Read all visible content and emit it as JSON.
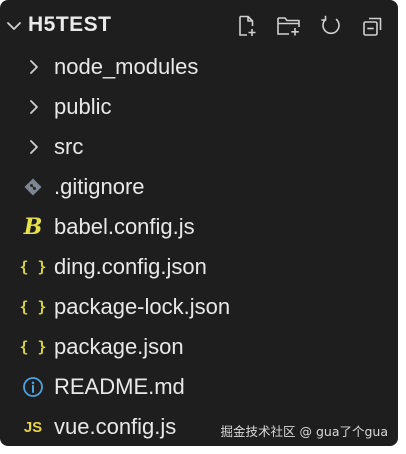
{
  "explorer": {
    "title": "H5TEST",
    "toolbar": [
      {
        "name": "new-file-icon",
        "icon": "new-file"
      },
      {
        "name": "new-folder-icon",
        "icon": "new-folder"
      },
      {
        "name": "refresh-icon",
        "icon": "refresh"
      },
      {
        "name": "collapse-all-icon",
        "icon": "collapse-all"
      }
    ],
    "items": [
      {
        "label": "node_modules",
        "type": "folder",
        "icon": "chevron-right"
      },
      {
        "label": "public",
        "type": "folder",
        "icon": "chevron-right"
      },
      {
        "label": "src",
        "type": "folder",
        "icon": "chevron-right"
      },
      {
        "label": ".gitignore",
        "type": "file",
        "icon": "git-diamond"
      },
      {
        "label": "babel.config.js",
        "type": "file",
        "icon": "babel"
      },
      {
        "label": "ding.config.json",
        "type": "file",
        "icon": "json-braces"
      },
      {
        "label": "package-lock.json",
        "type": "file",
        "icon": "json-braces"
      },
      {
        "label": "package.json",
        "type": "file",
        "icon": "json-braces"
      },
      {
        "label": "README.md",
        "type": "file",
        "icon": "info-circle"
      },
      {
        "label": "vue.config.js",
        "type": "file",
        "icon": "js"
      }
    ]
  },
  "icon_glyphs": {
    "json_braces": "{ }",
    "babel": "B",
    "js": "JS"
  },
  "colors": {
    "background": "#1e1e1e",
    "text": "#e8e8e8",
    "json_yellow": "#d4d44a",
    "babel_yellow": "#e6e04a",
    "info_blue": "#4aa3df",
    "js_yellow": "#e6d24a",
    "git_gray": "#7d8590"
  },
  "watermark": "掘金技术社区 @ gua了个gua"
}
